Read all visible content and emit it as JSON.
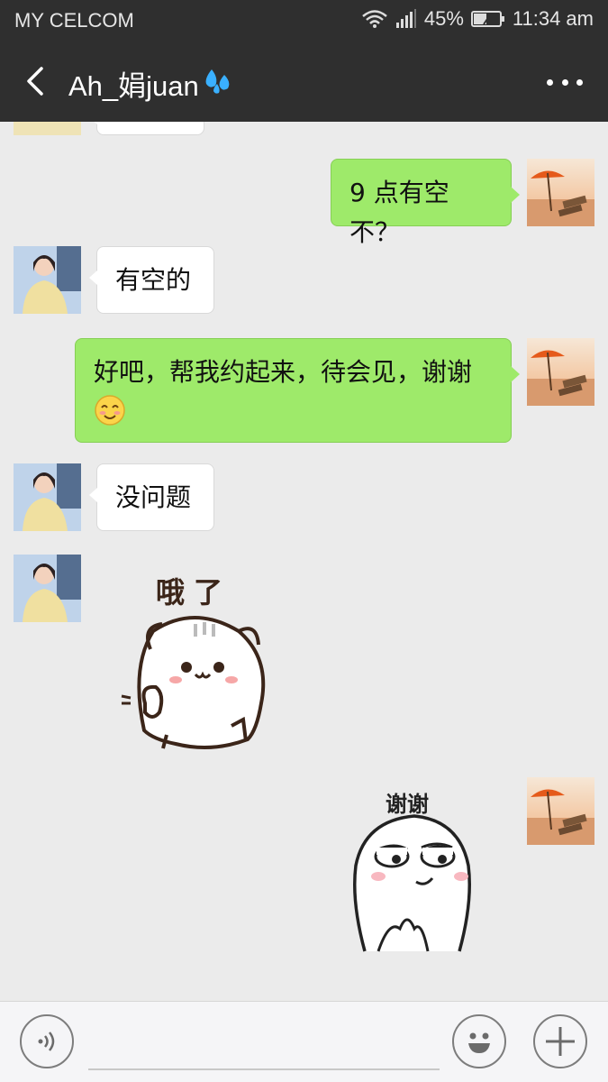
{
  "status_bar": {
    "carrier": "MY CELCOM",
    "battery": "45%",
    "time": "11:34 am"
  },
  "header": {
    "title": "Ah_娟juan",
    "back_icon": "chevron-left-icon",
    "more_icon": "more-dots-icon",
    "title_emoji": "sweat-droplets-emoji"
  },
  "messages": [
    {
      "side": "in",
      "type": "text",
      "text": ""
    },
    {
      "side": "out",
      "type": "text",
      "text": "9 点有空不？"
    },
    {
      "side": "in",
      "type": "text",
      "text": "有空的"
    },
    {
      "side": "out",
      "type": "text",
      "text": "好吧，帮我约起来，待会见，谢谢",
      "emoji": "blush-smile-emoji"
    },
    {
      "side": "in",
      "type": "text",
      "text": "没问题"
    },
    {
      "side": "in",
      "type": "sticker",
      "caption": "哦了",
      "sticker": "cat-ok-hand-sticker"
    },
    {
      "side": "out",
      "type": "sticker",
      "caption": "谢谢",
      "sticker": "round-face-thanks-sticker"
    }
  ],
  "input_bar": {
    "voice_icon": "voice-icon",
    "emoji_icon": "emoji-face-icon",
    "plus_icon": "plus-icon",
    "text_value": ""
  },
  "colors": {
    "header_bg": "#2f2f2f",
    "chat_bg": "#ebebeb",
    "outgoing_bubble": "#9eea6a",
    "incoming_bubble": "#ffffff"
  }
}
